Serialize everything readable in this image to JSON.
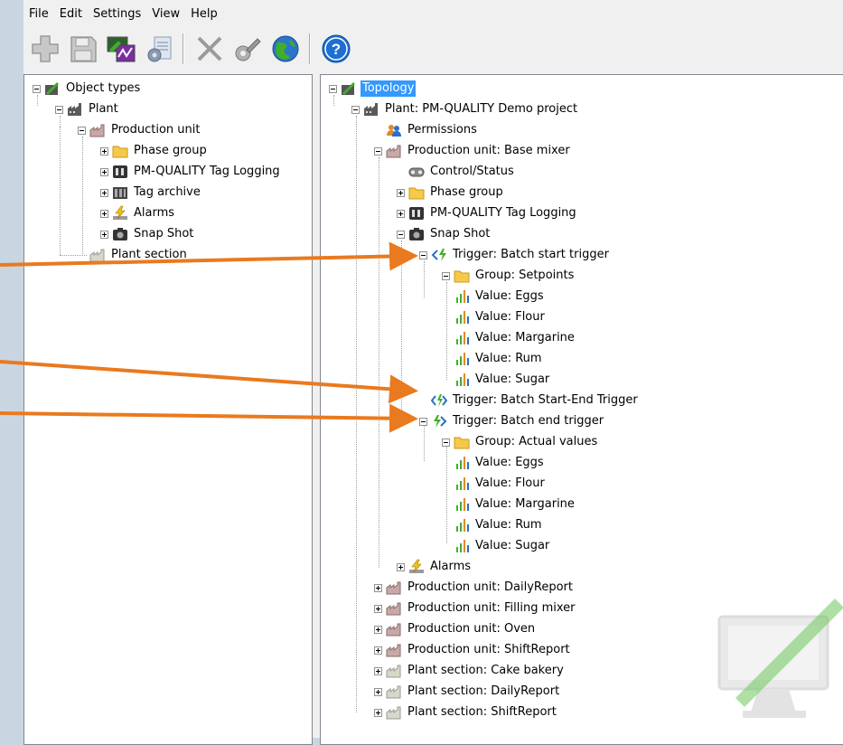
{
  "menu": {
    "file": "File",
    "edit": "Edit",
    "settings": "Settings",
    "view": "View",
    "help": "Help"
  },
  "toolbar": {
    "buttons": [
      "add-icon",
      "save-icon",
      "monitor-chart-icon",
      "configure-icon",
      "delete-icon",
      "tools-icon",
      "globe-icon",
      "help-icon"
    ]
  },
  "left_tree": {
    "root": "Object types",
    "plant": "Plant",
    "production_unit": "Production unit",
    "phase_group": "Phase group",
    "tag_logging": "PM-QUALITY Tag Logging",
    "tag_archive": "Tag archive",
    "alarms": "Alarms",
    "snap_shot": "Snap Shot",
    "plant_section": "Plant section"
  },
  "right_tree": {
    "root": "Topology",
    "plant": "Plant: PM-QUALITY Demo project",
    "permissions": "Permissions",
    "pu_base_mixer": "Production unit: Base mixer",
    "control_status": "Control/Status",
    "phase_group": "Phase group",
    "tag_logging": "PM-QUALITY Tag Logging",
    "snap_shot": "Snap Shot",
    "trigger_start": "Trigger: Batch start trigger",
    "group_setpoints": "Group: Setpoints",
    "sp_values": [
      "Value: Eggs",
      "Value: Flour",
      "Value: Margarine",
      "Value: Rum",
      "Value: Sugar"
    ],
    "trigger_start_end": "Trigger: Batch Start-End Trigger",
    "trigger_end": "Trigger: Batch end trigger",
    "group_actual": "Group: Actual values",
    "av_values": [
      "Value: Eggs",
      "Value: Flour",
      "Value: Margarine",
      "Value: Rum",
      "Value: Sugar"
    ],
    "alarms": "Alarms",
    "others": [
      "Production unit: DailyReport",
      "Production unit: Filling mixer",
      "Production unit: Oven",
      "Production unit: ShiftReport",
      "Plant section: Cake bakery",
      "Plant section: DailyReport",
      "Plant section: ShiftReport"
    ]
  },
  "colors": {
    "selection": "#3399ff",
    "arrow": "#e97a1f",
    "folder": "#f5c94a"
  }
}
